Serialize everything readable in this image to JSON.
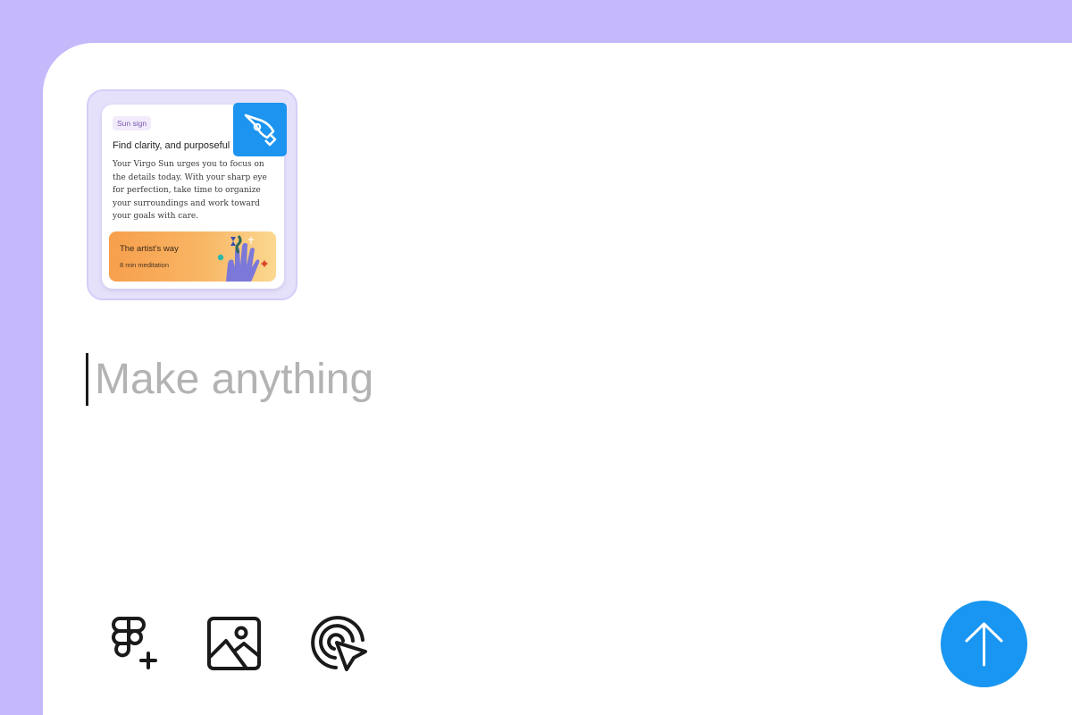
{
  "attachment": {
    "chip_label": "Sun sign",
    "title": "Find clarity, and purposeful",
    "body": "Your Virgo Sun urges you to focus on the details today. With your sharp eye for perfection, take time to organize your surroundings and work toward your goals with care.",
    "promo": {
      "title": "The artist’s way",
      "subtitle": "8 min meditation"
    },
    "badge_icon": "pen-tool-icon"
  },
  "prompt": {
    "placeholder": "Make anything",
    "value": ""
  },
  "toolbar": {
    "items": [
      {
        "name": "figma-add-icon"
      },
      {
        "name": "image-icon"
      },
      {
        "name": "target-cursor-icon"
      }
    ],
    "send_icon": "arrow-up-icon"
  },
  "colors": {
    "background": "#c5b8fb",
    "panel": "#ffffff",
    "accent_blue": "#1896f1",
    "placeholder_text": "#b3b3b3",
    "attachment_frame": "#e6e1fb",
    "promo_orange": "#f79f4c"
  }
}
